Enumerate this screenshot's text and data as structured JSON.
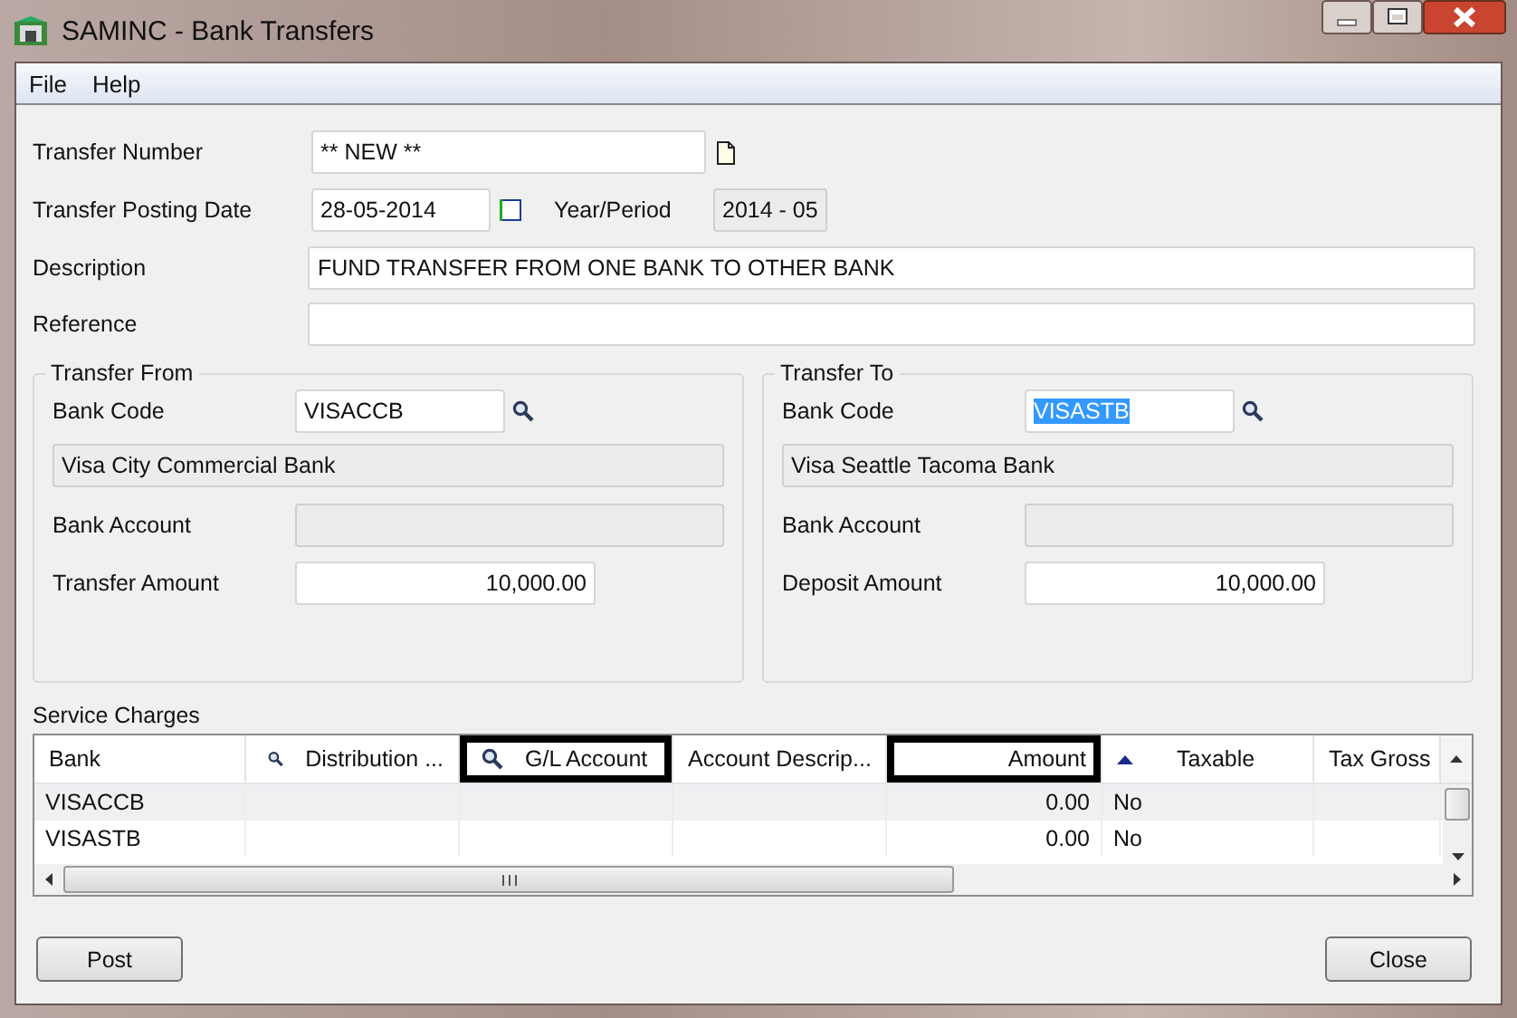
{
  "window": {
    "title": "SAMINC - Bank Transfers"
  },
  "menu": [
    "File",
    "Help"
  ],
  "transfer_number": {
    "label": "Transfer Number",
    "value": "** NEW **"
  },
  "posting_date": {
    "label": "Transfer Posting Date",
    "value": "28-05-2014"
  },
  "year_period": {
    "label": "Year/Period",
    "value": "2014 - 05"
  },
  "description": {
    "label": "Description",
    "value": "FUND TRANSFER FROM ONE BANK TO OTHER BANK"
  },
  "reference": {
    "label": "Reference"
  },
  "transfer_from": {
    "title": "Transfer From",
    "bank_code": {
      "label": "Bank Code",
      "value": "VISACCB",
      "selected": false
    },
    "bank_name": "Visa City Commercial Bank",
    "bank_account": {
      "label": "Bank Account"
    },
    "amount": {
      "label": "Transfer Amount",
      "value": "10,000.00"
    }
  },
  "transfer_to": {
    "title": "Transfer To",
    "bank_code": {
      "label": "Bank Code",
      "value": "VISASTB",
      "selected": true
    },
    "bank_name": "Visa Seattle Tacoma Bank",
    "bank_account": {
      "label": "Bank Account"
    },
    "amount": {
      "label": "Deposit Amount",
      "value": "10,000.00"
    }
  },
  "service_charges": {
    "title": "Service Charges",
    "columns": [
      {
        "label": "Bank",
        "lookup": false,
        "highlighted": false,
        "sorted": false
      },
      {
        "label": "Distribution ...",
        "lookup": true,
        "highlighted": false,
        "sorted": false
      },
      {
        "label": "G/L Account",
        "lookup": true,
        "highlighted": true,
        "sorted": false
      },
      {
        "label": "Account Descrip...",
        "lookup": false,
        "highlighted": false,
        "sorted": false
      },
      {
        "label": "Amount",
        "lookup": false,
        "highlighted": true,
        "sorted": false
      },
      {
        "label": "Taxable",
        "lookup": false,
        "highlighted": false,
        "sorted": true
      },
      {
        "label": "Tax Gross",
        "lookup": false,
        "highlighted": false,
        "sorted": false
      }
    ],
    "rows": [
      {
        "bank": "VISACCB",
        "amount": "0.00",
        "taxable": "No"
      },
      {
        "bank": "VISASTB",
        "amount": "0.00",
        "taxable": "No"
      }
    ]
  },
  "buttons": [
    "Post",
    "Close"
  ]
}
